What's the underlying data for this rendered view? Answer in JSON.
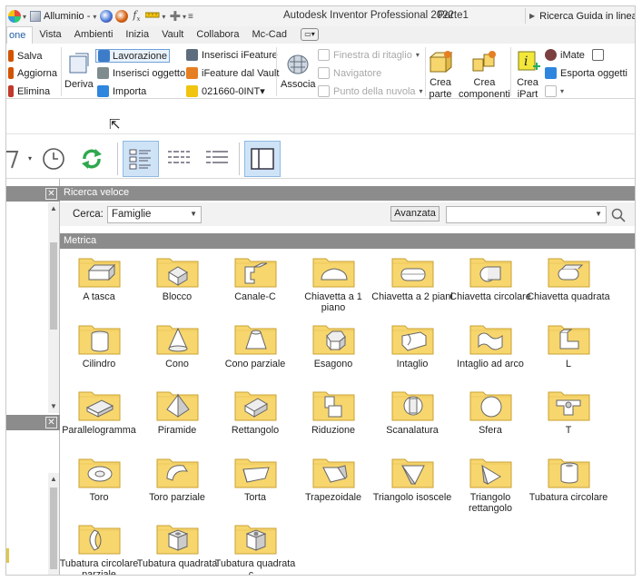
{
  "titlebar": {
    "material": "Alluminio -",
    "app_title": "Autodesk Inventor Professional 2022",
    "document": "Parte1",
    "help_search": "Ricerca Guida in linea e c"
  },
  "tabs": [
    "one",
    "Vista",
    "Ambienti",
    "Inizia",
    "Vault",
    "Collabora",
    "Mc-Cad"
  ],
  "ribbon": {
    "salva": "Salva",
    "aggiorna": "Aggiorna",
    "elimina": "Elimina",
    "deriva": "Deriva",
    "lavorazione": "Lavorazione",
    "inserisci_oggetto": "Inserisci oggetto",
    "importa": "Importa",
    "inserisci_ifeature": "Inserisci iFeature",
    "ifeature_dal_vault": "iFeature dal Vault",
    "codice": "021660-0INT▾",
    "associa": "Associa",
    "finestra_ritaglio": "Finestra di ritaglio",
    "navigatore": "Navigatore",
    "punto_nuvola": "Punto della nuvola",
    "crea_parte_1": "Crea",
    "crea_parte_2": "parte",
    "crea_componenti_1": "Crea",
    "crea_componenti_2": "componenti",
    "crea_ipart_1": "Crea",
    "crea_ipart_2": "iPart",
    "imate": "iMate",
    "esporta_oggetti": "Esporta oggetti"
  },
  "content_center": {
    "quick_search_title": "Ricerca veloce",
    "search_label": "Cerca:",
    "search_scope": "Famiglie",
    "advanced_button": "Avanzata",
    "search_value": "",
    "category_title": "Metrica",
    "items": [
      {
        "label": "A tasca",
        "shape": "pocket"
      },
      {
        "label": "Blocco",
        "shape": "block"
      },
      {
        "label": "Canale-C",
        "shape": "channel"
      },
      {
        "label": "Chiavetta a 1 piano",
        "shape": "key1"
      },
      {
        "label": "Chiavetta a 2 piani",
        "shape": "key2"
      },
      {
        "label": "Chiavetta circolare",
        "shape": "keyround"
      },
      {
        "label": "Chiavetta quadrata",
        "shape": "keysquare"
      },
      {
        "label": "Cilindro",
        "shape": "cylinder"
      },
      {
        "label": "Cono",
        "shape": "cone"
      },
      {
        "label": "Cono parziale",
        "shape": "frustum"
      },
      {
        "label": "Esagono",
        "shape": "hexagon"
      },
      {
        "label": "Intaglio",
        "shape": "notch"
      },
      {
        "label": "Intaglio ad arco",
        "shape": "arcnotch"
      },
      {
        "label": "L",
        "shape": "lshape"
      },
      {
        "label": "Parallelogramma",
        "shape": "parallelogram"
      },
      {
        "label": "Piramide",
        "shape": "pyramid"
      },
      {
        "label": "Rettangolo",
        "shape": "rectangle"
      },
      {
        "label": "Riduzione",
        "shape": "reduction"
      },
      {
        "label": "Scanalatura",
        "shape": "groove"
      },
      {
        "label": "Sfera",
        "shape": "sphere"
      },
      {
        "label": "T",
        "shape": "tshape"
      },
      {
        "label": "Toro",
        "shape": "torus"
      },
      {
        "label": "Toro parziale",
        "shape": "partialtorus"
      },
      {
        "label": "Torta",
        "shape": "pie"
      },
      {
        "label": "Trapezoidale",
        "shape": "trapezoid"
      },
      {
        "label": "Triangolo isoscele",
        "shape": "isosceles"
      },
      {
        "label": "Triangolo rettangolo",
        "shape": "righttriangle"
      },
      {
        "label": "Tubatura circolare",
        "shape": "tube"
      },
      {
        "label": "Tubatura circolare parziale",
        "shape": "partialtube"
      },
      {
        "label": "Tubatura quadrata",
        "shape": "squaretube"
      },
      {
        "label": "Tubatura quadrata c...",
        "shape": "squaretube2"
      }
    ]
  },
  "colors": {
    "folder": "#f7d66e",
    "folder_edge": "#c9a233",
    "panel_header": "#8c8c8c",
    "selected_view": "#cfe3f7",
    "accent_tab": "#1f5fa8"
  }
}
